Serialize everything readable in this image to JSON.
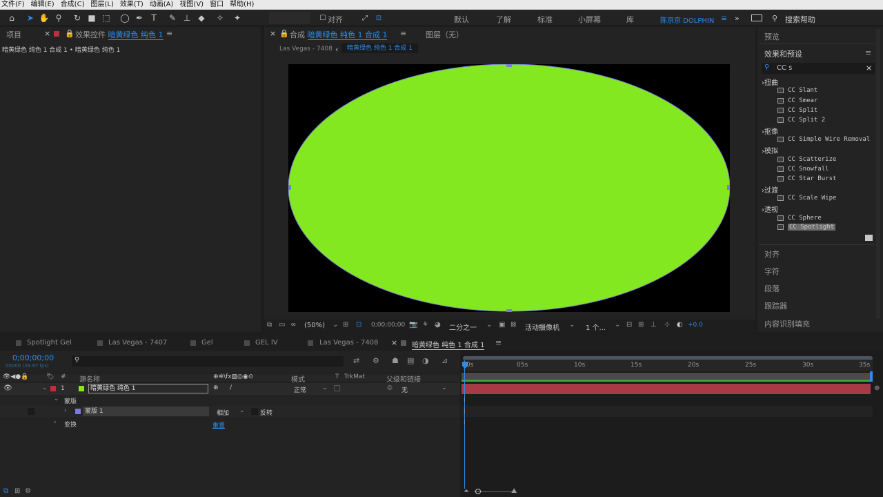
{
  "menu": [
    "文件(F)",
    "编辑(E)",
    "合成(C)",
    "图层(L)",
    "效果(T)",
    "动画(A)",
    "视图(V)",
    "窗口",
    "帮助(H)"
  ],
  "toolbar": {
    "snap_label": "对齐",
    "workspaces": [
      "默认",
      "了解",
      "标准",
      "小屏幕",
      "库"
    ],
    "active_workspace": "陈京京 DOLPHIN",
    "search_help": "搜索帮助"
  },
  "left_panel": {
    "tab_project": "项目",
    "tab_effects": "效果控件",
    "tab_effects_layer": "暗黄绿色 纯色 1",
    "breadcrumb": "暗黄绿色 纯色 1 合成 1 • 暗黄绿色 纯色 1"
  },
  "comp_panel": {
    "tab_prefix": "合成",
    "tab_name": "暗黄绿色 纯色 1 合成 1",
    "layer_tab": "图层（无）",
    "crumb_parent": "Las Vegas - 7408",
    "crumb_current": "暗黄绿色 纯色 1 合成 1",
    "zoom": "(50%)",
    "timecode": "0;00;00;00",
    "resolution": "二分之一",
    "camera": "活动摄像机",
    "views": "1 个...",
    "exposure": "+0.0"
  },
  "right_panel": {
    "preview": "预览",
    "effects_presets": "效果和预设",
    "search_value": "CC s",
    "categories": [
      {
        "name": "扭曲",
        "items": [
          "CC Slant",
          "CC Smear",
          "CC Split",
          "CC Split 2"
        ]
      },
      {
        "name": "抠像",
        "items": [
          "CC Simple Wire Removal"
        ]
      },
      {
        "name": "模拟",
        "items": [
          "CC Scatterize",
          "CC Snowfall",
          "CC Star Burst"
        ]
      },
      {
        "name": "过渡",
        "items": [
          "CC Scale Wipe"
        ]
      },
      {
        "name": "透视",
        "items": [
          "CC Sphere",
          "CC Spotlight"
        ]
      }
    ],
    "sections": [
      "对齐",
      "字符",
      "段落",
      "跟踪器",
      "内容识别填充"
    ]
  },
  "timeline": {
    "tabs": [
      "Spotlight Gel",
      "Las Vegas - 7407",
      "Gel",
      "GEL IV",
      "Las Vegas - 7408"
    ],
    "active_tab": "暗黄绿色 纯色 1 合成 1",
    "timecode": "0;00;00;00",
    "fps": "00000 (29.97 fps)",
    "col_source": "源名称",
    "col_mode": "模式",
    "col_t": "T",
    "col_trkmat": "TrkMat",
    "col_parent": "父级和链接",
    "layer_num": "1",
    "layer_name": "暗黄绿色 纯色 1",
    "layer_mode": "正常",
    "layer_parent": "无",
    "masks_label": "蒙版",
    "mask_name": "蒙版 1",
    "mask_mode": "相加",
    "mask_invert": "反转",
    "transform_label": "变换",
    "reset": "重置",
    "ruler": [
      "0s",
      "05s",
      "10s",
      "15s",
      "20s",
      "25s",
      "30s",
      "35s"
    ]
  },
  "colors": {
    "solid": "#84e820",
    "mask_outline": "#7a7adf",
    "accent_blue": "#2d8ceb",
    "layer_label_red": "#c02e3c",
    "track_bar": "#a83a48"
  }
}
